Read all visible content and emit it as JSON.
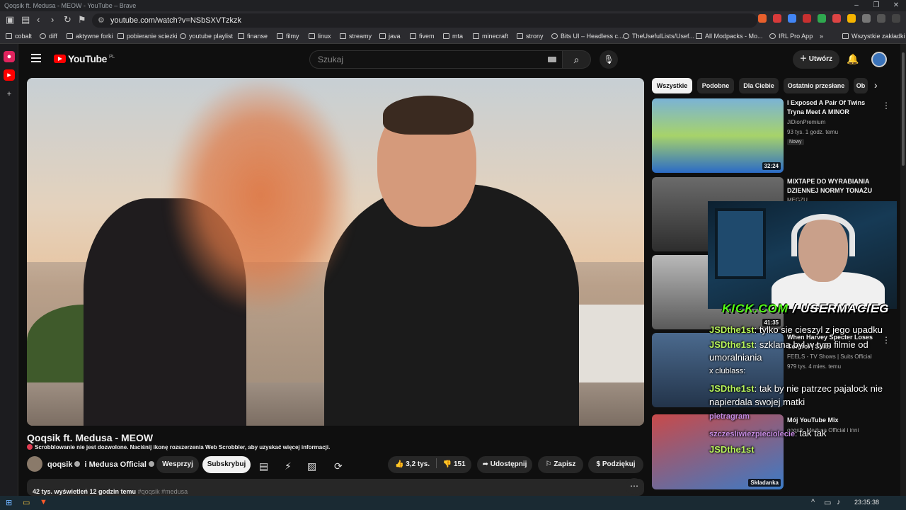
{
  "browser": {
    "title": "Qoqsik ft. Medusa - MEOW - YouTube – Brave",
    "url": "youtube.com/watch?v=NSbSXVTzkzk",
    "bookmarks": [
      "cobalt",
      "diff",
      "aktywne forki",
      "pobieranie sciezki",
      "youtube playlist",
      "finanse",
      "filmy",
      "linux",
      "streamy",
      "java",
      "fivem",
      "mta",
      "minecraft",
      "strony",
      "Bits UI – Headless c...",
      "TheUsefulLists/Usef...",
      "All Modpacks - Mo...",
      "IRL Pro App"
    ],
    "bookmarks_more": "»",
    "all_bookmarks": "Wszystkie zakładki"
  },
  "yt": {
    "logo": "YouTube",
    "region": "PL",
    "search_placeholder": "Szukaj",
    "create_label": "Utwórz"
  },
  "video": {
    "title": "Qoqsik ft. Medusa - MEOW",
    "scrobble_notice": "Scrobblowanie nie jest dozwolone. Naciśnij ikonę rozszerzenia Web Scrobbler, aby uzyskać więcej informacji.",
    "channel_a": "qoqsik",
    "channel_join": "i",
    "channel_b": "Medusa Official",
    "support_label": "Wesprzyj",
    "subscribe_label": "Subskrybuj",
    "likes": "3,2 tys.",
    "dislikes": "151",
    "share_label": "Udostępnij",
    "save_label": "Zapisz",
    "thanks_label": "Podziękuj",
    "desc_meta": "42 tys. wyświetleń  12 godzin temu",
    "desc_tags": "#qoqsik #medusa"
  },
  "sidebar": {
    "chips": [
      "Wszystkie",
      "Podobne",
      "Dla Ciebie",
      "Ostatnio przesłane",
      "Ob"
    ],
    "items": [
      {
        "title": "I Exposed A Pair Of Twins Tryna Meet A MINOR",
        "channel": "JiDionPremium",
        "meta": "93 tys.  1 godz. temu",
        "badge": "Nowy",
        "duration": "32:24"
      },
      {
        "title": "MIXTAPE DO WYRABIANIA DZIENNEJ NORMY TONAŻU",
        "channel": "MEGZU"
      },
      {
        "duration": "41:35"
      },
      {
        "title": "When Harvey Specter Loses Control | Suits",
        "channel": "FEELS - TV Shows | Suits Official",
        "meta": "979 tys.  4 mies. temu"
      },
      {
        "title": "Mój YouTube Mix",
        "channel": "qoqsik, Medusa Official i inni",
        "duration": "Składanka"
      }
    ]
  },
  "overlay": {
    "kick_a": "KICK.COM",
    "kick_sep": "/",
    "kick_b": "USERMACIEG",
    "chat": [
      {
        "user": "JSDthe1st",
        "text": "tylko sie cieszyl z jego upadku"
      },
      {
        "user": "JSDthe1st",
        "text": "szklana byl w tym filmie od"
      },
      {
        "user": "",
        "text": "umoralniania"
      },
      {
        "user": "",
        "text": "x clublass:"
      },
      {
        "user": "JSDthe1st",
        "text": "tak by nie patrzec pajalock nie"
      },
      {
        "user": "",
        "text": "napierdala swojej matki"
      },
      {
        "user": "pietragram",
        "text": ""
      },
      {
        "user": "szczesliwiezpieciolecie",
        "text": "tak tak"
      },
      {
        "user": "JSDthe1st",
        "text": ""
      }
    ]
  },
  "taskbar": {
    "clock": "23:35:38"
  },
  "colors": {
    "accent_red": "#ff0000",
    "kick_green": "#53fc18",
    "chat_user": "#b6f25a"
  }
}
